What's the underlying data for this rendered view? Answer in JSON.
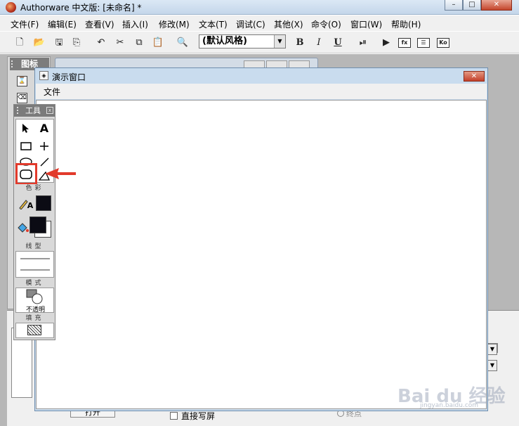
{
  "window": {
    "title": "Authorware 中文版: [未命名] *",
    "minimize": "–",
    "maximize": "□",
    "close": "✕"
  },
  "menu": [
    "文件(F)",
    "编辑(E)",
    "查看(V)",
    "插入(I)",
    "修改(M)",
    "文本(T)",
    "调试(C)",
    "其他(X)",
    "命令(O)",
    "窗口(W)",
    "帮助(H)"
  ],
  "toolbar": {
    "style_select": "(默认风格)",
    "bold": "B",
    "italic": "I",
    "underline": "U",
    "fx": "fx",
    "ko": "Ko",
    "icons": [
      "new-file-icon",
      "open-file-icon",
      "save-all-icon",
      "import-icon",
      "undo-icon",
      "cut-icon",
      "copy-icon",
      "paste-icon",
      "find-icon",
      "restart-icon",
      "run-icon",
      "functions-icon",
      "variables-icon",
      "knowledge-objects-icon"
    ]
  },
  "icon_panel": {
    "title": "图标"
  },
  "presentation": {
    "title": "演示窗口",
    "menu_file": "文件",
    "close": "✕"
  },
  "tools": {
    "title": "工具",
    "close": "x",
    "text_tool": "A",
    "sections": {
      "color": "色彩",
      "line": "线型",
      "mode": "模式",
      "mode_value": "不透明",
      "fill": "填充"
    },
    "foreground_color": "#0b0b14",
    "background_color": "#ffffff",
    "highlight_color": "#e23a2b"
  },
  "bottom": {
    "open_button": "打开",
    "checkbox_label": "直接写屏",
    "radio_label": "终点"
  },
  "watermark": {
    "text": "Bai du 经验",
    "sub": "jingyan.baidu.com"
  }
}
